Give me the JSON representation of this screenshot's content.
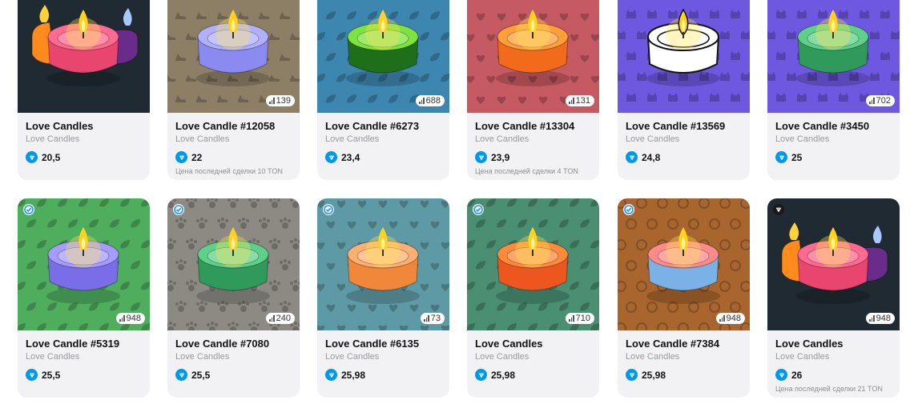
{
  "colors": {
    "ton": "#0098ea",
    "card_bg": "#f2f2f4"
  },
  "cards": [
    {
      "title": "Love Candles",
      "subtitle": "Love Candles",
      "price": "20,5",
      "count": "",
      "last_deal": "",
      "bg": "#1f2a33",
      "wax": "#e8466e",
      "rim": "#ff6a90",
      "pattern": "",
      "multi": true,
      "corner": ""
    },
    {
      "title": "Love Candle #12058",
      "subtitle": "Love Candles",
      "price": "22",
      "count": "139",
      "last_deal": "Цена последней сделки 10 TON",
      "bg": "#8c7f66",
      "wax": "#8a8af0",
      "rim": "#b0b0ff",
      "pattern": "shoe",
      "multi": false,
      "corner": ""
    },
    {
      "title": "Love Candle #6273",
      "subtitle": "Love Candles",
      "price": "23,4",
      "count": "688",
      "last_deal": "",
      "bg": "#3d86b0",
      "wax": "#1f6e1a",
      "rim": "#7ee23f",
      "pattern": "leaf",
      "multi": false,
      "corner": ""
    },
    {
      "title": "Love Candle #13304",
      "subtitle": "Love Candles",
      "price": "23,9",
      "count": "131",
      "last_deal": "Цена последней сделки 4 TON",
      "bg": "#c65a62",
      "wax": "#f26a1b",
      "rim": "#ff9f3a",
      "pattern": "heart",
      "multi": false,
      "corner": ""
    },
    {
      "title": "Love Candle #13569",
      "subtitle": "Love Candles",
      "price": "24,8",
      "count": "",
      "last_deal": "",
      "bg": "#6e58e0",
      "wax": "#ffffff",
      "rim": "#ffffff",
      "pattern": "cat",
      "multi": false,
      "corner": ""
    },
    {
      "title": "Love Candle #3450",
      "subtitle": "Love Candles",
      "price": "25",
      "count": "702",
      "last_deal": "",
      "bg": "#6e58e0",
      "wax": "#2f9a5a",
      "rim": "#5fd08a",
      "pattern": "cat",
      "multi": false,
      "corner": ""
    },
    {
      "title": "Love Candle #5319",
      "subtitle": "Love Candles",
      "price": "25,5",
      "count": "948",
      "last_deal": "",
      "bg": "#4fae5e",
      "wax": "#7a6ee8",
      "rim": "#a69cff",
      "pattern": "leaf",
      "multi": false,
      "corner": "check"
    },
    {
      "title": "Love Candle #7080",
      "subtitle": "Love Candles",
      "price": "25,5",
      "count": "240",
      "last_deal": "",
      "bg": "#8d8a84",
      "wax": "#2f9a5a",
      "rim": "#5fd08a",
      "pattern": "paw",
      "multi": false,
      "corner": "check"
    },
    {
      "title": "Love Candle #6135",
      "subtitle": "Love Candles",
      "price": "25,98",
      "count": "73",
      "last_deal": "",
      "bg": "#5e9aa5",
      "wax": "#f0873a",
      "rim": "#ffb070",
      "pattern": "heart",
      "multi": false,
      "corner": "check"
    },
    {
      "title": "Love Candles",
      "subtitle": "Love Candles",
      "price": "25,98",
      "count": "710",
      "last_deal": "",
      "bg": "#4a8f72",
      "wax": "#ee5620",
      "rim": "#ff8a3a",
      "pattern": "leaf",
      "multi": false,
      "corner": "check"
    },
    {
      "title": "Love Candle #7384",
      "subtitle": "Love Candles",
      "price": "25,98",
      "count": "948",
      "last_deal": "",
      "bg": "#a8652e",
      "wax": "#7ab2e8",
      "rim": "#ff8a8a",
      "pattern": "coin",
      "multi": false,
      "corner": "check"
    },
    {
      "title": "Love Candles",
      "subtitle": "Love Candles",
      "price": "26",
      "count": "948",
      "last_deal": "Цена последней сделки 21 TON",
      "bg": "#1f2a33",
      "wax": "#e8466e",
      "rim": "#ff6a90",
      "pattern": "",
      "multi": true,
      "corner": "ton"
    }
  ]
}
